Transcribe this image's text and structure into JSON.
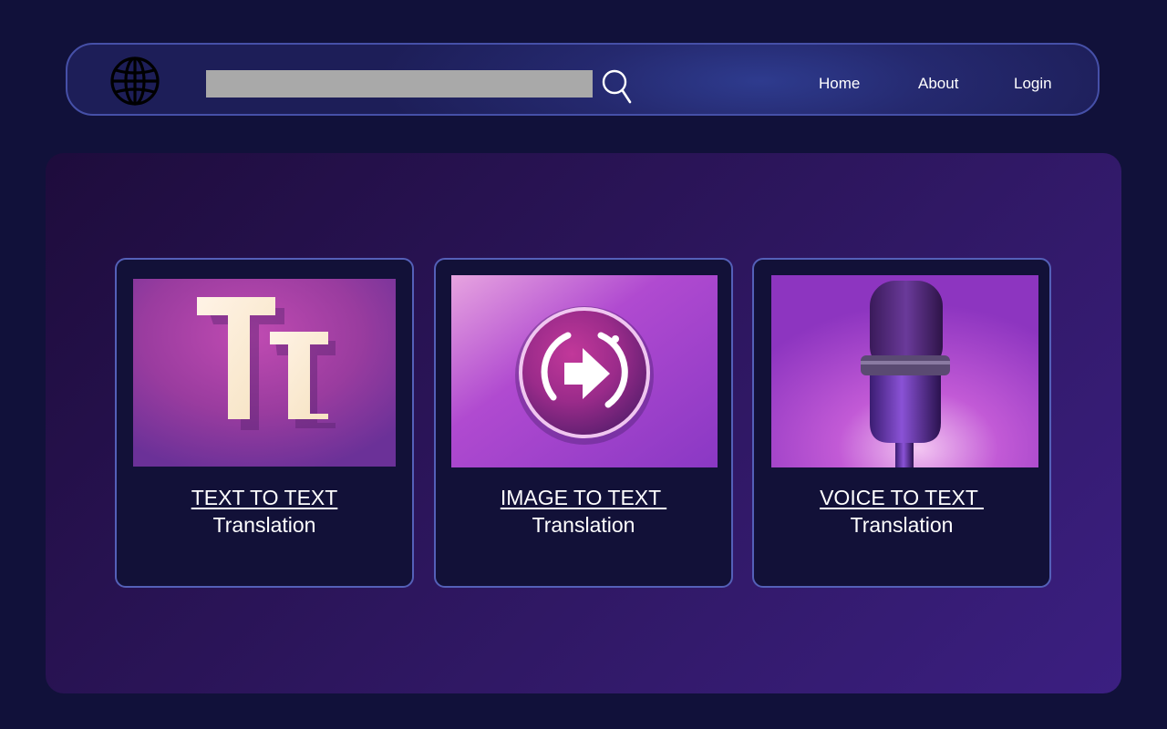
{
  "header": {
    "logo_icon": "globe-icon",
    "search": {
      "value": "",
      "placeholder": ""
    },
    "search_icon": "search-icon",
    "nav": [
      {
        "label": "Home"
      },
      {
        "label": "About"
      },
      {
        "label": "Login"
      }
    ]
  },
  "cards": [
    {
      "title": "TEXT TO TEXT",
      "subtitle": "Translation",
      "image": "text-translation-image"
    },
    {
      "title": "IMAGE TO TEXT ",
      "subtitle": "Translation",
      "image": "image-translation-image"
    },
    {
      "title": "VOICE TO TEXT ",
      "subtitle": "Translation",
      "image": "microphone-image"
    }
  ],
  "colors": {
    "page_bg": "#11113a",
    "nav_border": "#4650a8",
    "card_border": "#5460b8",
    "card_bg": "#121138",
    "search_bg": "#a9a9a9"
  }
}
